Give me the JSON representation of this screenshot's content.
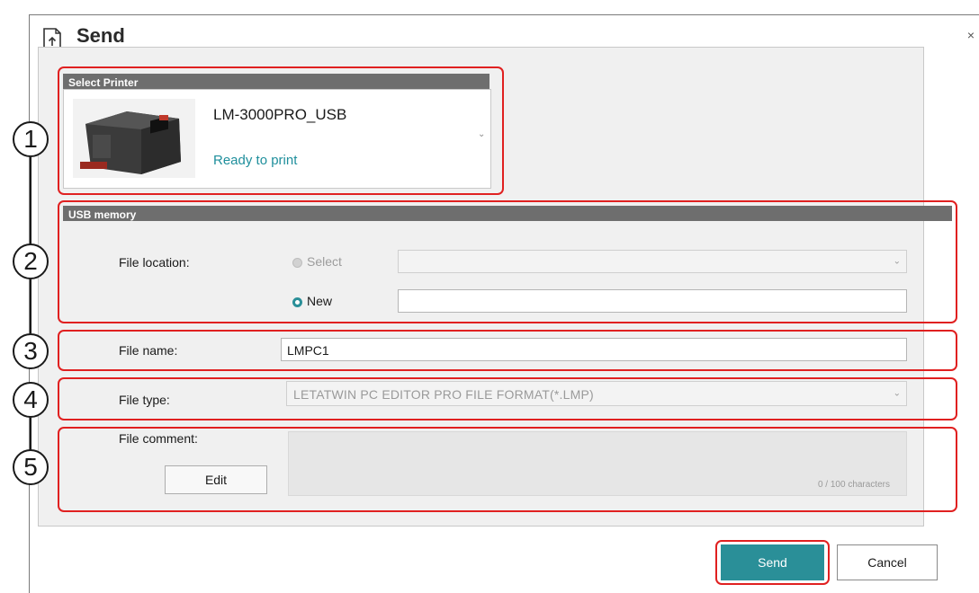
{
  "window": {
    "title": "Send",
    "close_glyph": "×"
  },
  "printer_section": {
    "header": "Select Printer",
    "printer_name": "LM-3000PRO_USB",
    "status": "Ready to print",
    "status_color": "#1f8f9c"
  },
  "usb_section": {
    "header": "USB memory",
    "file_location_label": "File location:",
    "select_option": "Select",
    "new_option": "New",
    "selected_option": "New",
    "select_value": "",
    "new_value": ""
  },
  "file_name": {
    "label": "File name:",
    "value": "LMPC1"
  },
  "file_type": {
    "label": "File type:",
    "value": "LETATWIN PC EDITOR PRO FILE FORMAT(*.LMP)"
  },
  "file_comment": {
    "label": "File comment:",
    "edit_button": "Edit",
    "value": "",
    "counter": "0 / 100 characters"
  },
  "footer": {
    "send_button": "Send",
    "cancel_button": "Cancel"
  },
  "annotations": {
    "numbers": [
      "1",
      "2",
      "3",
      "4",
      "5"
    ],
    "highlight_color": "#e02020"
  },
  "colors": {
    "accent": "#2a8f98",
    "header_gray": "#6e6e6e",
    "panel_bg": "#f0f0f0"
  }
}
